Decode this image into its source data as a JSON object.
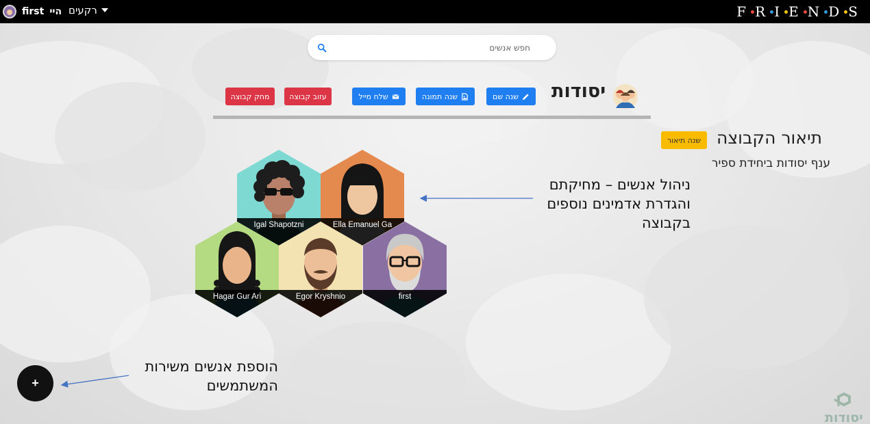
{
  "navbar": {
    "brand": "F·R·I·E·N·D·S",
    "brand_letters": [
      "F",
      "R",
      "I",
      "E",
      "N",
      "D",
      "S"
    ],
    "brand_dot_colors": [
      "#e74c3c",
      "#3498db",
      "#f1c40f",
      "#e74c3c",
      "#3498db",
      "#f1c40f"
    ],
    "user_greeting": "היי",
    "user_name": "first",
    "backgrounds_menu": "רקעים"
  },
  "search": {
    "placeholder": "חפש אנשים"
  },
  "group": {
    "title": "יסודות",
    "buttons": {
      "rename": "שנה שם",
      "change_image": "שנה תמונה",
      "send_mail": "שלח מייל",
      "leave_group": "עזוב קבוצה",
      "delete_group": "מחק קבוצה"
    },
    "description_title": "תיאור הקבוצה",
    "change_description": "שנה תיאור",
    "description_text": "ענף יסודות ביחידת ספיר"
  },
  "members": [
    {
      "name": "Igal Shapotzni",
      "bg": "#7fd9d3"
    },
    {
      "name": "Ella Emanuel Ga",
      "bg": "#e58a4f"
    },
    {
      "name": "Hagar Gur Ari",
      "bg": "#b4db82"
    },
    {
      "name": "Egor Kryshnio",
      "bg": "#f4e3b2"
    },
    {
      "name": "first",
      "bg": "#8a6fa3"
    }
  ],
  "annotations": {
    "manage_people": [
      "ניהול אנשים – מחיקתם",
      "והגדרת אדמינים נוספים",
      "בקבוצה"
    ],
    "add_people": [
      "הוספת אנשים משירות",
      "המשתמשים"
    ]
  },
  "fab": {
    "label": "+"
  },
  "watermark": {
    "text": "יסודות"
  },
  "colors": {
    "primary": "#1f7ff1",
    "danger": "#dc3545",
    "warning": "#f8bb00"
  }
}
